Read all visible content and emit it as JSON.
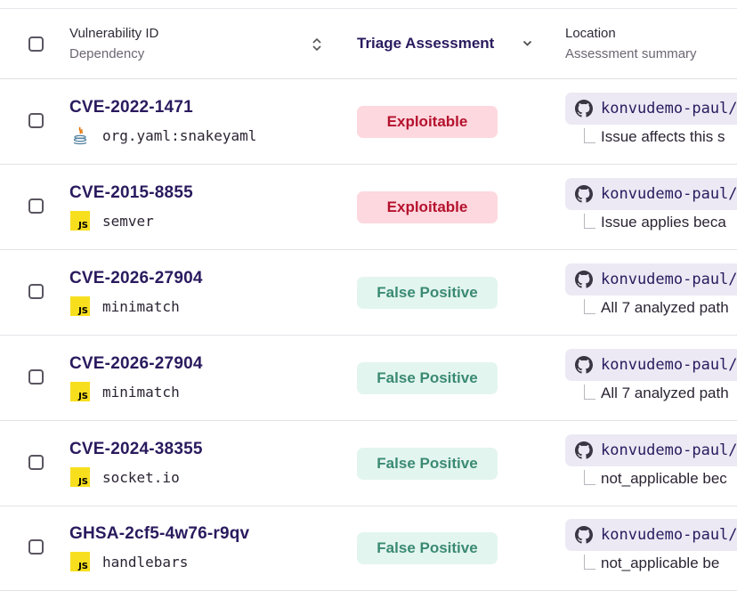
{
  "header": {
    "vuln_label": "Vulnerability ID",
    "dependency_label": "Dependency",
    "triage_label": "Triage Assessment",
    "location_label": "Location",
    "summary_label": "Assessment summary"
  },
  "rows": [
    {
      "cve": "CVE-2022-1471",
      "dep_type": "java",
      "dependency": "org.yaml:snakeyaml",
      "triage": "Exploitable",
      "location": "konvudemo-paul/",
      "summary": "Issue affects this s"
    },
    {
      "cve": "CVE-2015-8855",
      "dep_type": "js",
      "js_badge": "JS",
      "dependency": "semver",
      "triage": "Exploitable",
      "location": "konvudemo-paul/",
      "summary": "Issue applies beca"
    },
    {
      "cve": "CVE-2026-27904",
      "dep_type": "js",
      "js_badge": "JS",
      "dependency": "minimatch",
      "triage": "False Positive",
      "location": "konvudemo-paul/",
      "summary": "All 7 analyzed path"
    },
    {
      "cve": "CVE-2026-27904",
      "dep_type": "js",
      "js_badge": "JS",
      "dependency": "minimatch",
      "triage": "False Positive",
      "location": "konvudemo-paul/",
      "summary": "All 7 analyzed path"
    },
    {
      "cve": "CVE-2024-38355",
      "dep_type": "js",
      "js_badge": "JS",
      "dependency": "socket.io",
      "triage": "False Positive",
      "location": "konvudemo-paul/",
      "summary": "not_applicable bec"
    },
    {
      "cve": "GHSA-2cf5-4w76-r9qv",
      "dep_type": "js",
      "js_badge": "JS",
      "dependency": "handlebars",
      "triage": "False Positive",
      "location": "konvudemo-paul/",
      "summary": "not_applicable be"
    }
  ],
  "colors": {
    "accent": "#2a1a5e",
    "exploitable_bg": "#fdd8de",
    "exploitable_text": "#b5122e",
    "false_positive_bg": "#e3f5ef",
    "false_positive_text": "#3a8a72",
    "js_yellow": "#f7df1e"
  },
  "icons": {
    "sort": "sort-arrows-icon",
    "dropdown": "chevron-down-icon",
    "location": "github-icon",
    "java": "java-icon",
    "js": "javascript-icon"
  }
}
